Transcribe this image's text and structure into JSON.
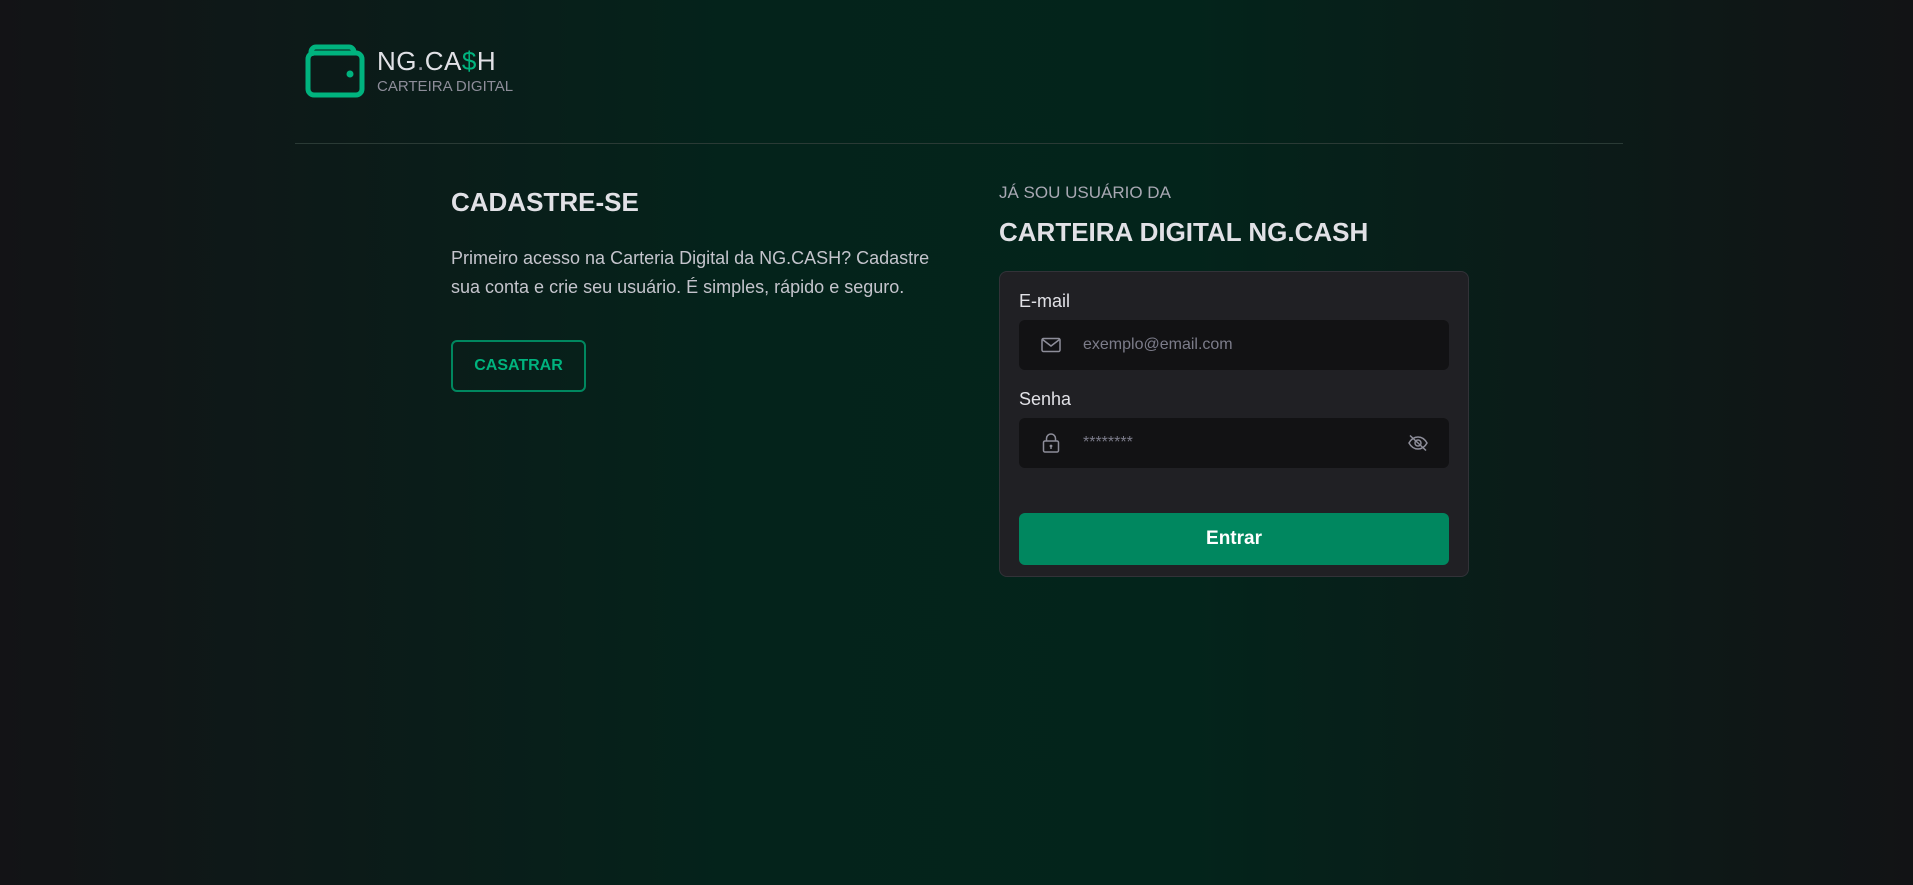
{
  "header": {
    "brand_prefix": "NG",
    "brand_dot": ".",
    "brand_ca": "CA",
    "brand_dollar": "$",
    "brand_h": "H",
    "subtitle": "CARTEIRA DIGITAL"
  },
  "register": {
    "title": "CADASTRE-SE",
    "description": "Primeiro acesso na Carteria Digital da NG.CASH? Cadastre sua conta e crie seu usuário. É simples, rápido e seguro.",
    "button_label": "CASATRAR"
  },
  "login": {
    "kicker": "JÁ SOU USUÁRIO DA",
    "title": "CARTEIRA DIGITAL NG.CASH",
    "email_label": "E-mail",
    "email_placeholder": "exemplo@email.com",
    "password_label": "Senha",
    "password_placeholder": "********",
    "submit_label": "Entrar"
  },
  "icons": {
    "logo": "wallet-icon",
    "email": "mail-icon",
    "password": "lock-icon",
    "toggle": "eye-off-icon"
  },
  "colors": {
    "accent": "#00b37e",
    "primary_button": "#00875f",
    "card_bg": "#202024",
    "input_bg": "#121214"
  }
}
